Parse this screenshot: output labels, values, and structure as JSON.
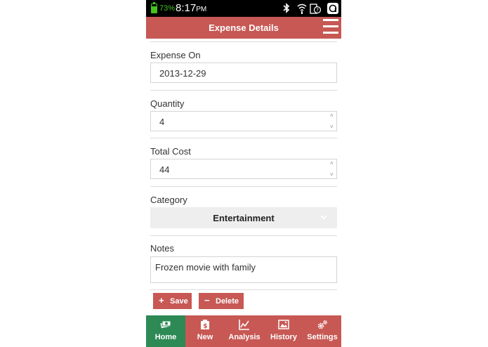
{
  "status_bar": {
    "battery_percent": "73%",
    "battery_level": 0.73,
    "time": "8:17",
    "ampm": "PM"
  },
  "header": {
    "title": "Expense Details",
    "menu_icon": "hamburger-menu-icon"
  },
  "form": {
    "expense_on": {
      "label": "Expense On",
      "value": "2013-12-29"
    },
    "quantity": {
      "label": "Quantity",
      "value": "4"
    },
    "total_cost": {
      "label": "Total Cost",
      "value": "44"
    },
    "category": {
      "label": "Category",
      "value": "Entertainment"
    },
    "notes": {
      "label": "Notes",
      "value": "Frozen movie with family"
    }
  },
  "actions": {
    "save_label": "Save",
    "delete_label": "Delete"
  },
  "nav": {
    "items": [
      {
        "label": "Home",
        "icon": "home-money-icon",
        "active": true
      },
      {
        "label": "New",
        "icon": "new-expense-icon",
        "active": false
      },
      {
        "label": "Analysis",
        "icon": "analysis-chart-icon",
        "active": false
      },
      {
        "label": "History",
        "icon": "history-icon",
        "active": false
      },
      {
        "label": "Settings",
        "icon": "settings-gears-icon",
        "active": false
      }
    ]
  },
  "colors": {
    "accent": "#c75854",
    "nav_active": "#2d8a55",
    "battery": "#44c21f"
  }
}
